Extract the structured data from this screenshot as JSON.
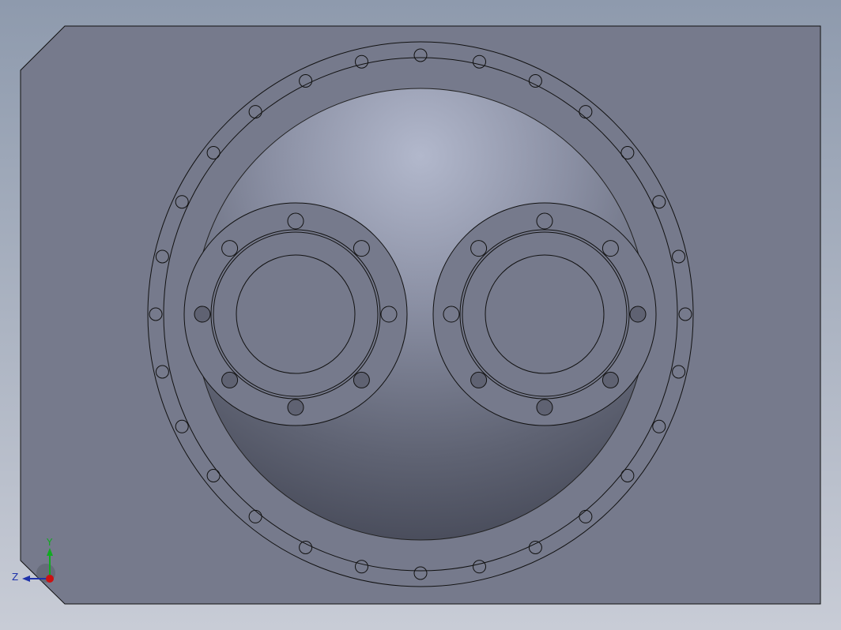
{
  "viewport": {
    "background_top": "#8e9aad",
    "background_bottom": "#c8ccd6",
    "plate_color": "#767a8c",
    "edge_color": "#000000"
  },
  "model": {
    "large_flange_bolt_count": 28,
    "small_flange_bolt_count": 8,
    "small_flange_count": 2
  },
  "triad": {
    "y_label": "Y",
    "z_label": "Z",
    "x_color": "#cc1111",
    "y_color": "#11aa22",
    "z_color": "#1f33aa"
  }
}
